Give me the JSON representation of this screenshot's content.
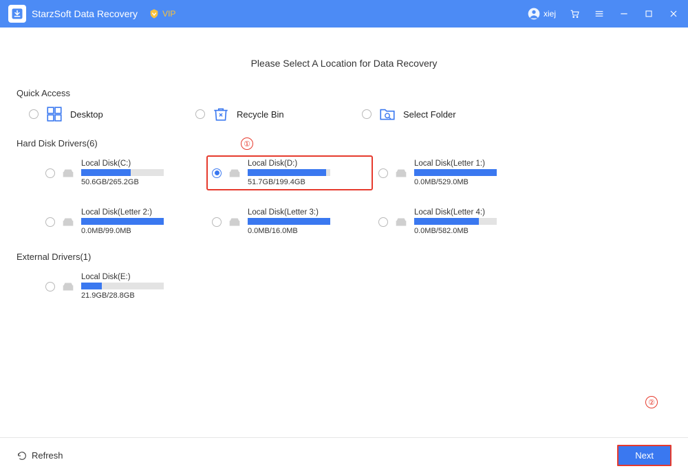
{
  "titlebar": {
    "app_name": "StarzSoft Data Recovery",
    "vip": "VIP",
    "user": "xiej"
  },
  "page_title": "Please Select A Location for Data Recovery",
  "sections": {
    "quick_access": "Quick Access",
    "hard_disk": "Hard Disk Drivers(6)",
    "external": "External Drivers(1)"
  },
  "quick": {
    "desktop": "Desktop",
    "recycle_bin": "Recycle Bin",
    "select_folder": "Select Folder"
  },
  "disks": {
    "c": {
      "name": "Local Disk(C:)",
      "size": "50.6GB/265.2GB",
      "pct": 60
    },
    "d": {
      "name": "Local Disk(D:)",
      "size": "51.7GB/199.4GB",
      "pct": 95
    },
    "l1": {
      "name": "Local Disk(Letter 1:)",
      "size": "0.0MB/529.0MB",
      "pct": 100
    },
    "l2": {
      "name": "Local Disk(Letter 2:)",
      "size": "0.0MB/99.0MB",
      "pct": 100
    },
    "l3": {
      "name": "Local Disk(Letter 3:)",
      "size": "0.0MB/16.0MB",
      "pct": 100
    },
    "l4": {
      "name": "Local Disk(Letter 4:)",
      "size": "0.0MB/582.0MB",
      "pct": 78
    },
    "e": {
      "name": "Local Disk(E:)",
      "size": "21.9GB/28.8GB",
      "pct": 25
    }
  },
  "footer": {
    "refresh": "Refresh",
    "next": "Next"
  },
  "annotations": {
    "a1": "①",
    "a2": "②"
  }
}
